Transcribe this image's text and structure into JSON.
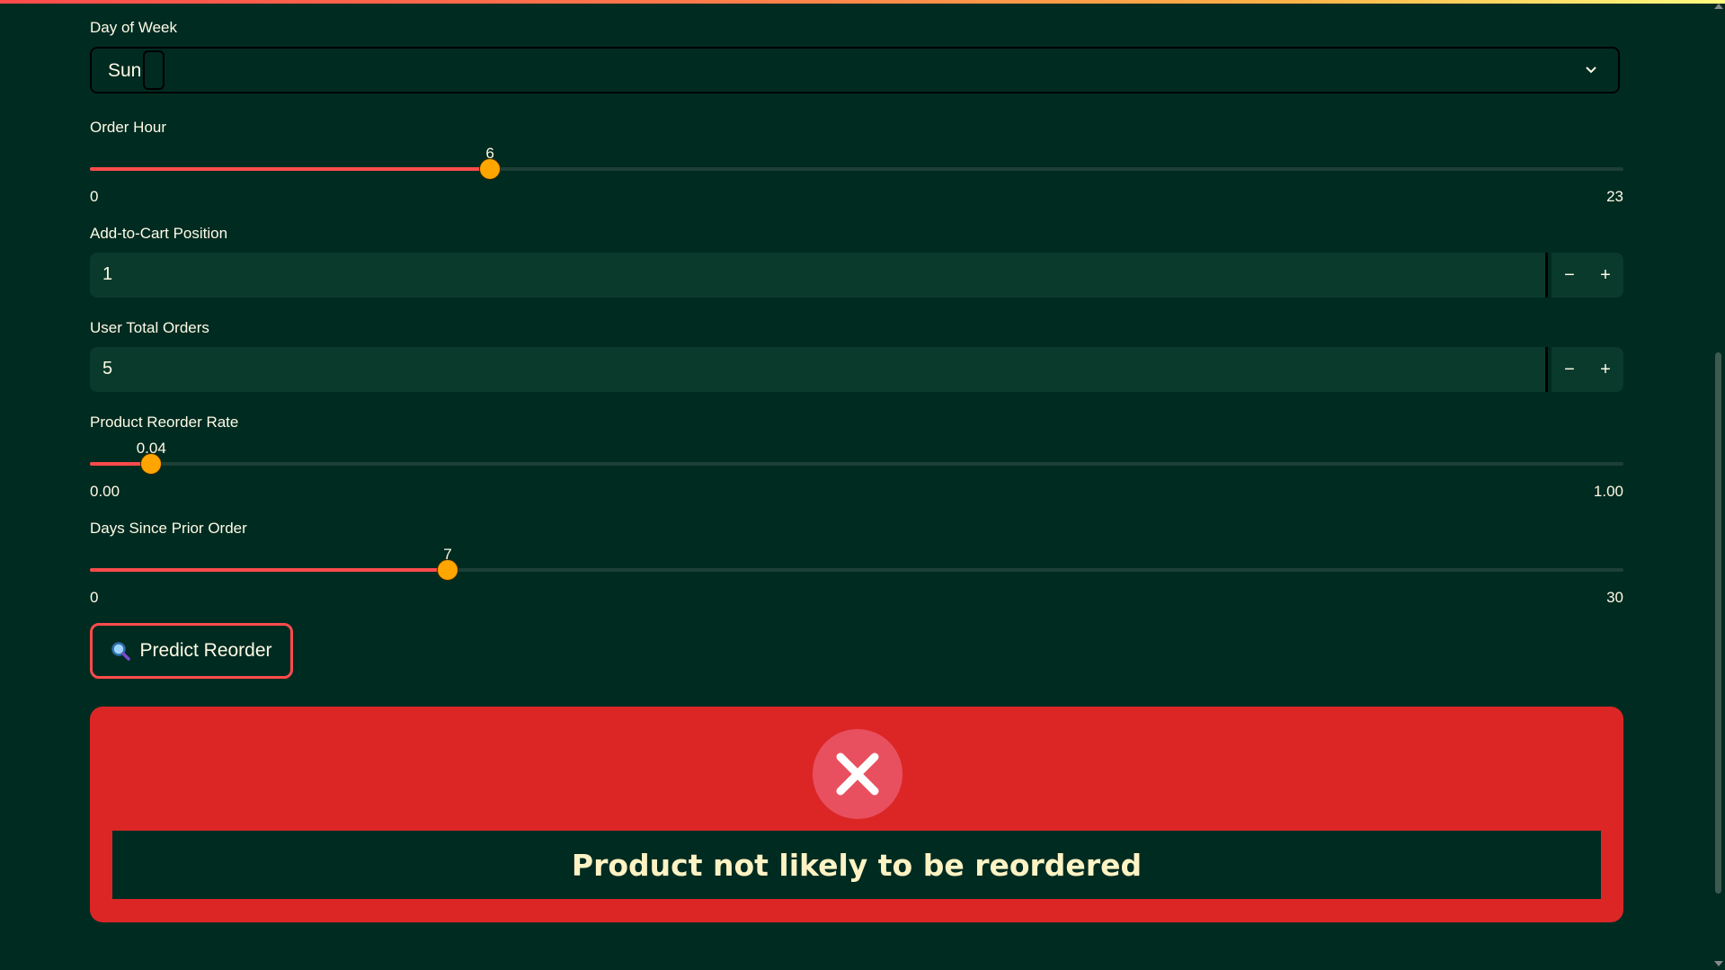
{
  "form": {
    "day_of_week": {
      "label": "Day of Week",
      "value": "Sun"
    },
    "order_hour": {
      "label": "Order Hour",
      "value": "6",
      "min": "0",
      "max": "23",
      "fraction": 0.2609
    },
    "add_to_cart_position": {
      "label": "Add-to-Cart Position",
      "value": "1",
      "minus": "−",
      "plus": "+"
    },
    "user_total_orders": {
      "label": "User Total Orders",
      "value": "5",
      "minus": "−",
      "plus": "+"
    },
    "product_reorder_rate": {
      "label": "Product Reorder Rate",
      "value": "0.04",
      "min": "0.00",
      "max": "1.00",
      "fraction": 0.04
    },
    "days_since_prior_order": {
      "label": "Days Since Prior Order",
      "value": "7",
      "min": "0",
      "max": "30",
      "fraction": 0.2333
    },
    "predict_button": {
      "label": "Predict Reorder",
      "icon": "magnifier-icon"
    }
  },
  "result": {
    "icon": "x-icon",
    "message": "Product not likely to be reordered"
  },
  "colors": {
    "background": "#002b21",
    "accent": "#ff4b4b",
    "thumb": "#ffa500",
    "result_bg": "#dc2626"
  }
}
